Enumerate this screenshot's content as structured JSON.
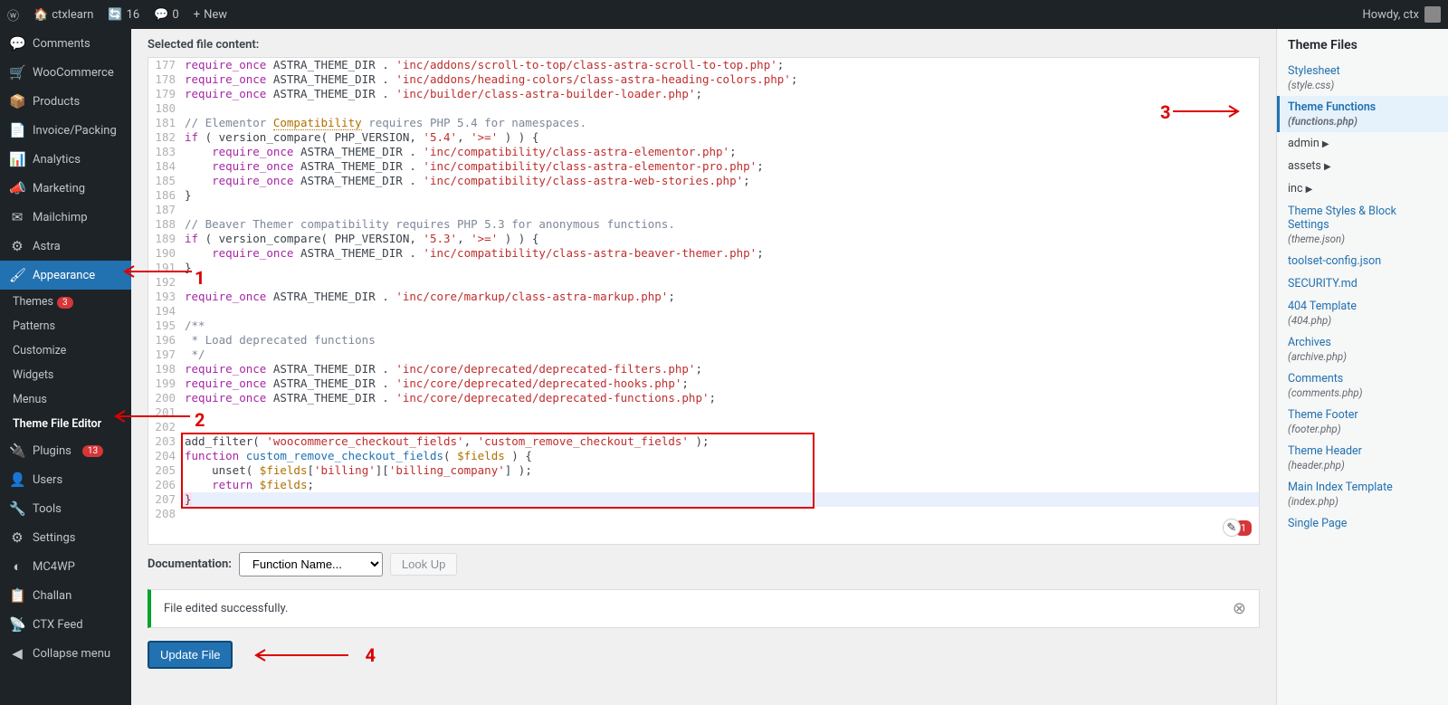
{
  "topbar": {
    "site_title": "ctxlearn",
    "pending": "16",
    "comments": "0",
    "new": "New",
    "howdy": "Howdy, ctx"
  },
  "sidebar": {
    "items": [
      {
        "label": "Comments",
        "icon": "💬"
      },
      {
        "label": "WooCommerce",
        "icon": "🛒"
      },
      {
        "label": "Products",
        "icon": "📦"
      },
      {
        "label": "Invoice/Packing",
        "icon": "📄"
      },
      {
        "label": "Analytics",
        "icon": "📊"
      },
      {
        "label": "Marketing",
        "icon": "📣"
      },
      {
        "label": "Mailchimp",
        "icon": "✉"
      },
      {
        "label": "Astra",
        "icon": "⚙"
      }
    ],
    "appearance": "Appearance",
    "sub": [
      {
        "label": "Themes",
        "badge": "3"
      },
      {
        "label": "Patterns"
      },
      {
        "label": "Customize"
      },
      {
        "label": "Widgets"
      },
      {
        "label": "Menus"
      },
      {
        "label": "Theme File Editor",
        "active": true
      }
    ],
    "after": [
      {
        "label": "Plugins",
        "icon": "🔌",
        "badge": "13"
      },
      {
        "label": "Users",
        "icon": "👤"
      },
      {
        "label": "Tools",
        "icon": "🔧"
      },
      {
        "label": "Settings",
        "icon": "⚙"
      },
      {
        "label": "MC4WP",
        "icon": "◐"
      },
      {
        "label": "Challan",
        "icon": "📋"
      },
      {
        "label": "CTX Feed",
        "icon": "📡"
      }
    ],
    "collapse": "Collapse menu"
  },
  "editor": {
    "label": "Selected file content:",
    "doc_label": "Documentation:",
    "doc_select": "Function Name...",
    "lookup": "Look Up",
    "notice": "File edited successfully.",
    "update": "Update File",
    "error_badge": "1",
    "lines": [
      {
        "n": 177,
        "t": "req",
        "txt": "'inc/addons/scroll-to-top/class-astra-scroll-to-top.php'"
      },
      {
        "n": 178,
        "t": "req",
        "txt": "'inc/addons/heading-colors/class-astra-heading-colors.php'"
      },
      {
        "n": 179,
        "t": "req",
        "txt": "'inc/builder/class-astra-builder-loader.php'"
      },
      {
        "n": 180,
        "t": "blank"
      },
      {
        "n": 181,
        "t": "com",
        "txt": "// Elementor ",
        "link": "Compatibility",
        "after": " requires PHP 5.4 for namespaces."
      },
      {
        "n": 182,
        "t": "if",
        "ver": "'5.4'"
      },
      {
        "n": 183,
        "t": "req2",
        "txt": "'inc/compatibility/class-astra-elementor.php'"
      },
      {
        "n": 184,
        "t": "req2",
        "txt": "'inc/compatibility/class-astra-elementor-pro.php'"
      },
      {
        "n": 185,
        "t": "req2",
        "txt": "'inc/compatibility/class-astra-web-stories.php'"
      },
      {
        "n": 186,
        "t": "close"
      },
      {
        "n": 187,
        "t": "blank"
      },
      {
        "n": 188,
        "t": "com",
        "txt": "// Beaver Themer compatibility requires PHP 5.3 for anonymous functions."
      },
      {
        "n": 189,
        "t": "if",
        "ver": "'5.3'"
      },
      {
        "n": 190,
        "t": "req2",
        "txt": "'inc/compatibility/class-astra-beaver-themer.php'"
      },
      {
        "n": 191,
        "t": "close"
      },
      {
        "n": 192,
        "t": "blank"
      },
      {
        "n": 193,
        "t": "req",
        "txt": "'inc/core/markup/class-astra-markup.php'"
      },
      {
        "n": 194,
        "t": "blank"
      },
      {
        "n": 195,
        "t": "doc",
        "txt": "/**"
      },
      {
        "n": 196,
        "t": "doc",
        "txt": " * Load deprecated functions"
      },
      {
        "n": 197,
        "t": "doc",
        "txt": " */"
      },
      {
        "n": 198,
        "t": "req",
        "txt": "'inc/core/deprecated/deprecated-filters.php'"
      },
      {
        "n": 199,
        "t": "req",
        "txt": "'inc/core/deprecated/deprecated-hooks.php'"
      },
      {
        "n": 200,
        "t": "req",
        "txt": "'inc/core/deprecated/deprecated-functions.php'"
      },
      {
        "n": 201,
        "t": "blank"
      },
      {
        "n": 202,
        "t": "blank"
      },
      {
        "n": 203,
        "t": "add"
      },
      {
        "n": 204,
        "t": "fn"
      },
      {
        "n": 205,
        "t": "unset"
      },
      {
        "n": 206,
        "t": "ret"
      },
      {
        "n": 207,
        "t": "cl2",
        "hl": true
      },
      {
        "n": 208,
        "t": "blank"
      }
    ]
  },
  "files": {
    "title": "Theme Files",
    "items": [
      {
        "label": "Stylesheet",
        "sub": "(style.css)"
      },
      {
        "label": "Theme Functions",
        "sub": "(functions.php)",
        "active": true
      },
      {
        "label": "admin",
        "folder": true
      },
      {
        "label": "assets",
        "folder": true
      },
      {
        "label": "inc",
        "folder": true
      },
      {
        "label": "Theme Styles & Block Settings",
        "sub": "(theme.json)"
      },
      {
        "label": "toolset-config.json"
      },
      {
        "label": "SECURITY.md"
      },
      {
        "label": "404 Template",
        "sub": "(404.php)"
      },
      {
        "label": "Archives",
        "sub": "(archive.php)"
      },
      {
        "label": "Comments",
        "sub": "(comments.php)"
      },
      {
        "label": "Theme Footer",
        "sub": "(footer.php)"
      },
      {
        "label": "Theme Header",
        "sub": "(header.php)"
      },
      {
        "label": "Main Index Template",
        "sub": "(index.php)"
      },
      {
        "label": "Single Page"
      }
    ]
  },
  "markers": {
    "m1": "1",
    "m2": "2",
    "m3": "3",
    "m4": "4"
  }
}
